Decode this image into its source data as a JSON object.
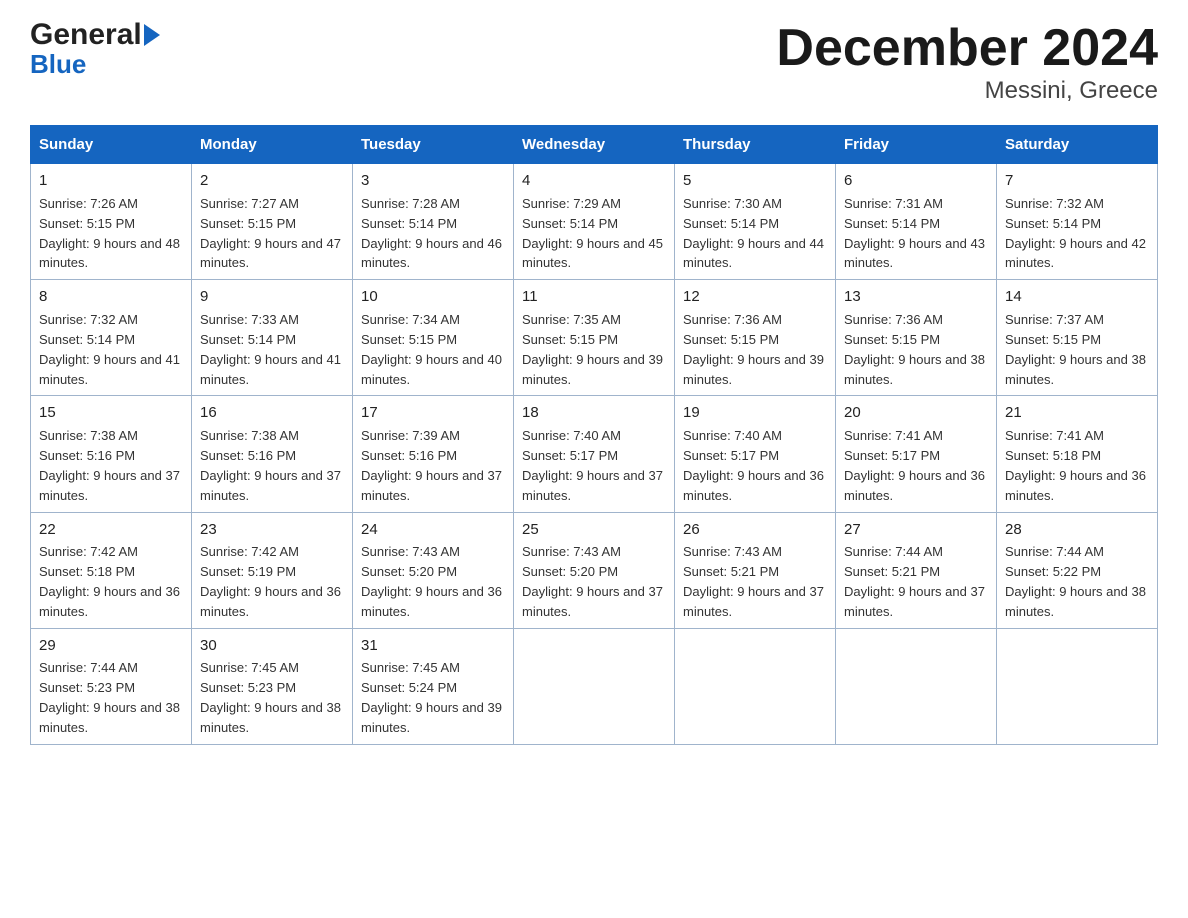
{
  "logo": {
    "general": "General",
    "blue": "Blue"
  },
  "header": {
    "month_year": "December 2024",
    "location": "Messini, Greece"
  },
  "days_of_week": [
    "Sunday",
    "Monday",
    "Tuesday",
    "Wednesday",
    "Thursday",
    "Friday",
    "Saturday"
  ],
  "weeks": [
    [
      {
        "day": "1",
        "sunrise": "7:26 AM",
        "sunset": "5:15 PM",
        "daylight": "9 hours and 48 minutes."
      },
      {
        "day": "2",
        "sunrise": "7:27 AM",
        "sunset": "5:15 PM",
        "daylight": "9 hours and 47 minutes."
      },
      {
        "day": "3",
        "sunrise": "7:28 AM",
        "sunset": "5:14 PM",
        "daylight": "9 hours and 46 minutes."
      },
      {
        "day": "4",
        "sunrise": "7:29 AM",
        "sunset": "5:14 PM",
        "daylight": "9 hours and 45 minutes."
      },
      {
        "day": "5",
        "sunrise": "7:30 AM",
        "sunset": "5:14 PM",
        "daylight": "9 hours and 44 minutes."
      },
      {
        "day": "6",
        "sunrise": "7:31 AM",
        "sunset": "5:14 PM",
        "daylight": "9 hours and 43 minutes."
      },
      {
        "day": "7",
        "sunrise": "7:32 AM",
        "sunset": "5:14 PM",
        "daylight": "9 hours and 42 minutes."
      }
    ],
    [
      {
        "day": "8",
        "sunrise": "7:32 AM",
        "sunset": "5:14 PM",
        "daylight": "9 hours and 41 minutes."
      },
      {
        "day": "9",
        "sunrise": "7:33 AM",
        "sunset": "5:14 PM",
        "daylight": "9 hours and 41 minutes."
      },
      {
        "day": "10",
        "sunrise": "7:34 AM",
        "sunset": "5:15 PM",
        "daylight": "9 hours and 40 minutes."
      },
      {
        "day": "11",
        "sunrise": "7:35 AM",
        "sunset": "5:15 PM",
        "daylight": "9 hours and 39 minutes."
      },
      {
        "day": "12",
        "sunrise": "7:36 AM",
        "sunset": "5:15 PM",
        "daylight": "9 hours and 39 minutes."
      },
      {
        "day": "13",
        "sunrise": "7:36 AM",
        "sunset": "5:15 PM",
        "daylight": "9 hours and 38 minutes."
      },
      {
        "day": "14",
        "sunrise": "7:37 AM",
        "sunset": "5:15 PM",
        "daylight": "9 hours and 38 minutes."
      }
    ],
    [
      {
        "day": "15",
        "sunrise": "7:38 AM",
        "sunset": "5:16 PM",
        "daylight": "9 hours and 37 minutes."
      },
      {
        "day": "16",
        "sunrise": "7:38 AM",
        "sunset": "5:16 PM",
        "daylight": "9 hours and 37 minutes."
      },
      {
        "day": "17",
        "sunrise": "7:39 AM",
        "sunset": "5:16 PM",
        "daylight": "9 hours and 37 minutes."
      },
      {
        "day": "18",
        "sunrise": "7:40 AM",
        "sunset": "5:17 PM",
        "daylight": "9 hours and 37 minutes."
      },
      {
        "day": "19",
        "sunrise": "7:40 AM",
        "sunset": "5:17 PM",
        "daylight": "9 hours and 36 minutes."
      },
      {
        "day": "20",
        "sunrise": "7:41 AM",
        "sunset": "5:17 PM",
        "daylight": "9 hours and 36 minutes."
      },
      {
        "day": "21",
        "sunrise": "7:41 AM",
        "sunset": "5:18 PM",
        "daylight": "9 hours and 36 minutes."
      }
    ],
    [
      {
        "day": "22",
        "sunrise": "7:42 AM",
        "sunset": "5:18 PM",
        "daylight": "9 hours and 36 minutes."
      },
      {
        "day": "23",
        "sunrise": "7:42 AM",
        "sunset": "5:19 PM",
        "daylight": "9 hours and 36 minutes."
      },
      {
        "day": "24",
        "sunrise": "7:43 AM",
        "sunset": "5:20 PM",
        "daylight": "9 hours and 36 minutes."
      },
      {
        "day": "25",
        "sunrise": "7:43 AM",
        "sunset": "5:20 PM",
        "daylight": "9 hours and 37 minutes."
      },
      {
        "day": "26",
        "sunrise": "7:43 AM",
        "sunset": "5:21 PM",
        "daylight": "9 hours and 37 minutes."
      },
      {
        "day": "27",
        "sunrise": "7:44 AM",
        "sunset": "5:21 PM",
        "daylight": "9 hours and 37 minutes."
      },
      {
        "day": "28",
        "sunrise": "7:44 AM",
        "sunset": "5:22 PM",
        "daylight": "9 hours and 38 minutes."
      }
    ],
    [
      {
        "day": "29",
        "sunrise": "7:44 AM",
        "sunset": "5:23 PM",
        "daylight": "9 hours and 38 minutes."
      },
      {
        "day": "30",
        "sunrise": "7:45 AM",
        "sunset": "5:23 PM",
        "daylight": "9 hours and 38 minutes."
      },
      {
        "day": "31",
        "sunrise": "7:45 AM",
        "sunset": "5:24 PM",
        "daylight": "9 hours and 39 minutes."
      },
      null,
      null,
      null,
      null
    ]
  ],
  "labels": {
    "sunrise": "Sunrise:",
    "sunset": "Sunset:",
    "daylight": "Daylight:"
  },
  "colors": {
    "header_bg": "#1565c0",
    "header_text": "#ffffff",
    "border": "#a0b4cc"
  }
}
